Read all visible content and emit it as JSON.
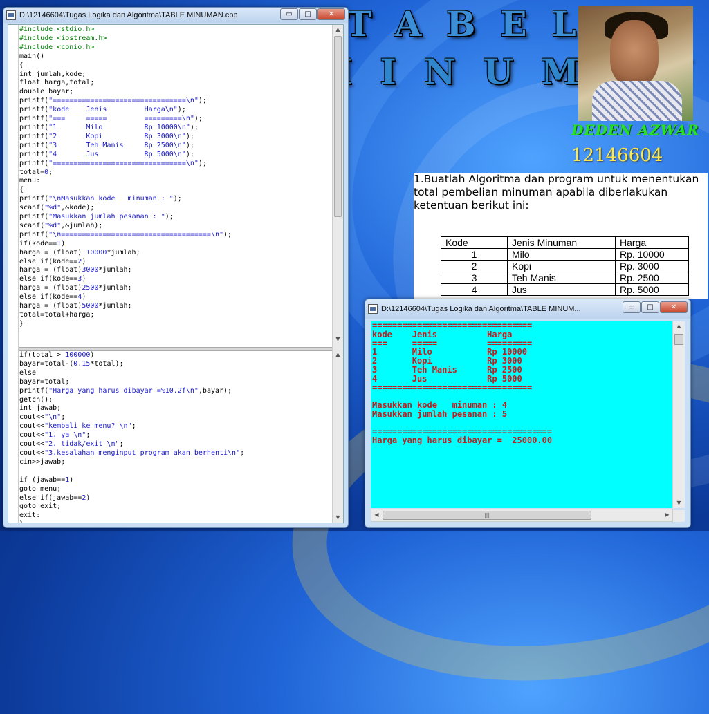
{
  "editor": {
    "title": "D:\\12146604\\Tugas Logika dan Algoritma\\TABLE MINUMAN.cpp",
    "code_top": [
      "#include <stdio.h>",
      "#include <iostream.h>",
      "#include <conio.h>",
      "main()",
      "{",
      "int jumlah,kode;",
      "float harga,total;",
      "double bayar;",
      "printf(\"================================\\n\");",
      "printf(\"kode    Jenis         Harga\\n\");",
      "printf(\"===     =====         =========\\n\");",
      "printf(\"1       Milo          Rp 10000\\n\");",
      "printf(\"2       Kopi          Rp 3000\\n\");",
      "printf(\"3       Teh Manis     Rp 2500\\n\");",
      "printf(\"4       Jus           Rp 5000\\n\");",
      "printf(\"================================\\n\");",
      "total=0;",
      "menu:",
      "{",
      "printf(\"\\nMasukkan kode   minuman : \");",
      "scanf(\"%d\",&kode);",
      "printf(\"Masukkan jumlah pesanan : \");",
      "scanf(\"%d\",&jumlah);",
      "printf(\"\\n====================================\\n\");",
      "if(kode==1)",
      "harga = (float) 10000*jumlah;",
      "else if(kode==2)",
      "harga = (float)3000*jumlah;",
      "else if(kode==3)",
      "harga = (float)2500*jumlah;",
      "else if(kode==4)",
      "harga = (float)5000*jumlah;",
      "total=total+harga;",
      "}"
    ],
    "code_bottom": [
      "if(total > 100000)",
      "bayar=total-(0.15*total);",
      "else",
      "bayar=total;",
      "printf(\"Harga yang harus dibayar =%10.2f\\n\",bayar);",
      "getch();",
      "int jawab;",
      "cout<<\"\\n\";",
      "cout<<\"kembali ke menu? \\n\";",
      "cout<<\"1. ya \\n\";",
      "cout<<\"2. tidak/exit \\n\";",
      "cout<<\"3.kesalahan menginput program akan berhenti\\n\";",
      "cin>>jawab;",
      "",
      "if (jawab==1)",
      "goto menu;",
      "else if(jawab==2)",
      "goto exit;",
      "exit:",
      "}"
    ]
  },
  "slide": {
    "title_line1": "TABEL",
    "title_line2": "MINUMAN",
    "author_name": "DEDEN AZWAR",
    "author_id": "12146604",
    "question": "1.Buatlah Algoritma dan program untuk menentukan total pembelian minuman apabila diberlakukan ketentuan berikut ini:",
    "table": {
      "headers": [
        "Kode",
        "Jenis Minuman",
        "Harga"
      ],
      "rows": [
        [
          "1",
          "Milo",
          "Rp.  10000"
        ],
        [
          "2",
          "Kopi",
          "Rp.   3000"
        ],
        [
          "3",
          "Teh Manis",
          "Rp.   2500"
        ],
        [
          "4",
          "Jus",
          "Rp.   5000"
        ]
      ]
    }
  },
  "console": {
    "title": "D:\\12146604\\Tugas Logika dan Algoritma\\TABLE MINUM...",
    "lines": [
      "================================",
      "kode    Jenis          Harga",
      "===     =====          =========",
      "1       Milo           Rp 10000",
      "2       Kopi           Rp 3000",
      "3       Teh Manis      Rp 2500",
      "4       Jus            Rp 5000",
      "================================",
      "",
      "Masukkan kode   minuman : 4",
      "Masukkan jumlah pesanan : 5",
      "",
      "====================================",
      "Harga yang harus dibayar =  25000.00"
    ],
    "bg_color": "#00ffff",
    "text_color": "#c81a1a"
  },
  "window_controls": {
    "minimize": "▭",
    "maximize": "□",
    "close": "✕"
  },
  "icons": {
    "scroll_up": "▲",
    "scroll_down": "▼",
    "scroll_left": "◀",
    "scroll_right": "▶",
    "grip": "|||"
  }
}
